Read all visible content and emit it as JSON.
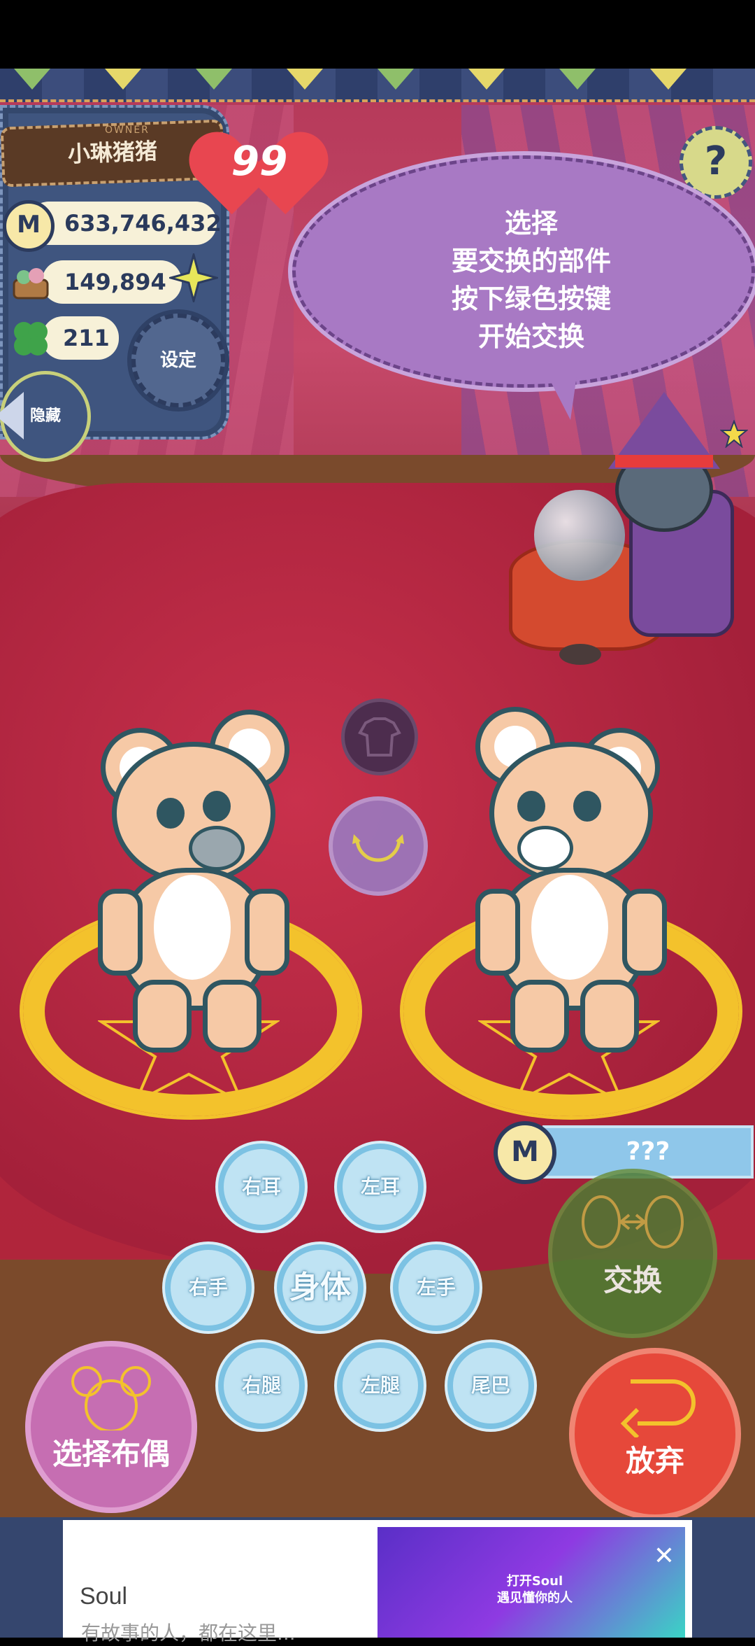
{
  "player": {
    "name": "小琳猪猪",
    "owner_label": "OWNER",
    "coins": "633,746,432",
    "items": "149,894",
    "clovers": "211",
    "hearts": "99",
    "coin_symbol": "M"
  },
  "buttons": {
    "settings": "设定",
    "hide": "隐藏",
    "help": "?",
    "swap": "交换",
    "choose_doll": "选择布偶",
    "give_up": "放弃"
  },
  "speech_bubble": {
    "lines": [
      "选择",
      "要交换的部件",
      "按下绿色按键",
      "开始交换"
    ]
  },
  "cost": {
    "coin_symbol": "M",
    "value": "???"
  },
  "parts": {
    "right_ear": "右耳",
    "left_ear": "左耳",
    "right_hand": "右手",
    "body": "身体",
    "left_hand": "左手",
    "right_leg": "右腿",
    "left_leg": "左腿",
    "tail": "尾巴"
  },
  "ad": {
    "app_name": "Soul",
    "tagline": "有故事的人，都在这里...",
    "image_text_1": "打开Soul",
    "image_text_2": "遇见懂你的人",
    "close": "✕"
  },
  "colors": {
    "stage_red": "#b3243f",
    "curtain_pink": "#c6496a",
    "panel_blue": "#3f557f",
    "part_button_blue": "#bfe3f3",
    "swap_green": "#4f7b33",
    "choose_purple": "#c66eb2",
    "giveup_red": "#e6483a",
    "magic_gold": "#f3c22c"
  }
}
